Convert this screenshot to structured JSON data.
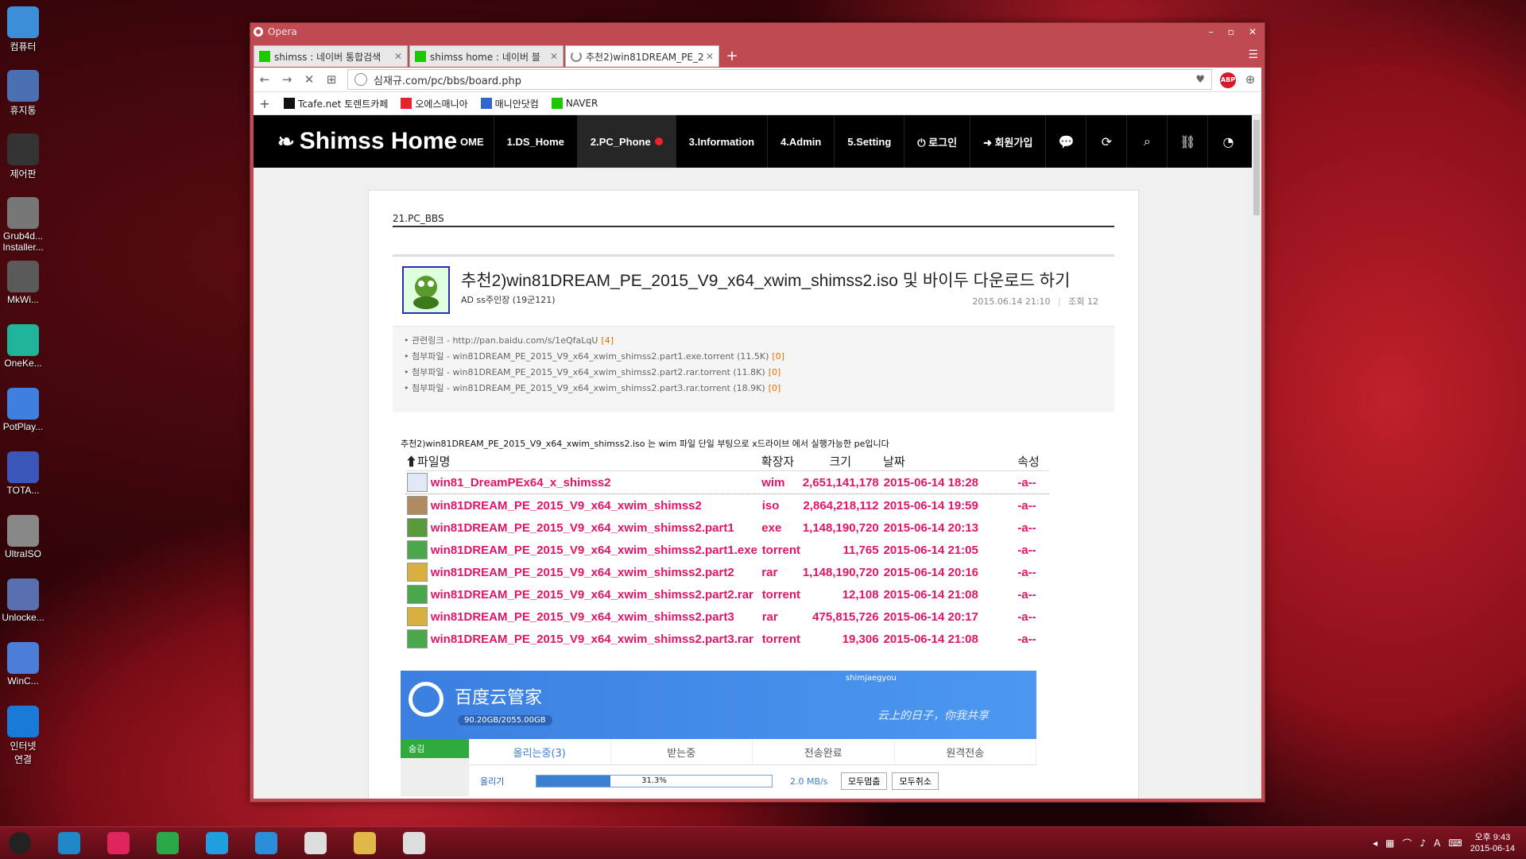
{
  "desktop": {
    "icons": [
      {
        "label": "컴퓨터",
        "color": "#3b8fd8"
      },
      {
        "label": "휴지통",
        "color": "#4a6fb2"
      },
      {
        "label": "제어판",
        "color": "#333333"
      },
      {
        "label": "Grub4d...\nInstaller...",
        "color": "#777777"
      },
      {
        "label": "MkWi...",
        "color": "#5a5a5a"
      },
      {
        "label": "OneKe...",
        "color": "#1db49a"
      },
      {
        "label": "PotPlay...",
        "color": "#3f7fe0"
      },
      {
        "label": "TOTA...",
        "color": "#3a56b8"
      },
      {
        "label": "UltraISO",
        "color": "#888888"
      },
      {
        "label": "Unlocke...",
        "color": "#5a6fb0"
      },
      {
        "label": "WinC...",
        "color": "#4a7ed8"
      },
      {
        "label": "인터넷\n연결",
        "color": "#1a7ad8"
      }
    ]
  },
  "browser": {
    "app_name": "Opera",
    "tabs": [
      {
        "title": "shimss : 네이버 통합검색",
        "fav_color": "#1ec800"
      },
      {
        "title": "shimss home : 네이버 블",
        "fav_color": "#1ec800"
      },
      {
        "title": "추천2)win81DREAM_PE_2",
        "fav_color": "#888888"
      }
    ],
    "new_tab": "+",
    "url": "심재규.com/pc/bbs/board.php",
    "bookmarks": [
      {
        "label": "Tcafe.net 토렌트카페",
        "color": "#111111"
      },
      {
        "label": "오에스매니아",
        "color": "#e8232c"
      },
      {
        "label": "매니안닷컴",
        "color": "#3366cc"
      },
      {
        "label": "NAVER",
        "color": "#1ec800"
      }
    ]
  },
  "site": {
    "logo": "Shimss Home",
    "nav": [
      {
        "label": "OME"
      },
      {
        "label": "1.DS_Home"
      },
      {
        "label": "2.PC_Phone"
      },
      {
        "label": "3.Information"
      },
      {
        "label": "4.Admin"
      },
      {
        "label": "5.Setting"
      },
      {
        "label": "⏻ 로그인"
      },
      {
        "label": "➜ 회원가입"
      }
    ],
    "board_name": "21.PC_BBS",
    "post": {
      "title": "추천2)win81DREAM_PE_2015_V9_x64_xwim_shimss2.iso 및 바이두 다운로드 하기",
      "author": "AD ss주인장 (19군121)",
      "date": "2015.06.14 21:10",
      "views": "조회 12",
      "links": [
        {
          "text": "관련링크 - http://pan.baidu.com/s/1eQfaLqU",
          "count": "[4]"
        },
        {
          "text": "첨부파일 - win81DREAM_PE_2015_V9_x64_xwim_shimss2.part1.exe.torrent (11.5K)",
          "count": "[0]"
        },
        {
          "text": "첨부파일 - win81DREAM_PE_2015_V9_x64_xwim_shimss2.part2.rar.torrent (11.8K)",
          "count": "[0]"
        },
        {
          "text": "첨부파일 - win81DREAM_PE_2015_V9_x64_xwim_shimss2.part3.rar.torrent (18.9K)",
          "count": "[0]"
        }
      ],
      "description": "추천2)win81DREAM_PE_2015_V9_x64_xwim_shimss2.iso 는 wim 파일 단일 부팅으로 x드라이브 에서 실행가능한 pe입니다"
    },
    "file_list": {
      "headers": [
        "파일명",
        "확장자",
        "크기",
        "날짜",
        "속성"
      ],
      "rows": [
        {
          "name": "win81_DreamPEx64_x_shimss2",
          "ext": "wim",
          "size": "2,651,141,178",
          "date": "2015-06-14 18:28",
          "attr": "-a--",
          "icon": "#dfe8f4"
        },
        {
          "name": "win81DREAM_PE_2015_V9_x64_xwim_shimss2",
          "ext": "iso",
          "size": "2,864,218,112",
          "date": "2015-06-14 19:59",
          "attr": "-a--",
          "icon": "#b08a60"
        },
        {
          "name": "win81DREAM_PE_2015_V9_x64_xwim_shimss2.part1",
          "ext": "exe",
          "size": "1,148,190,720",
          "date": "2015-06-14 20:13",
          "attr": "-a--",
          "icon": "#5a9a3a"
        },
        {
          "name": "win81DREAM_PE_2015_V9_x64_xwim_shimss2.part1.exe",
          "ext": "torrent",
          "size": "11,765",
          "date": "2015-06-14 21:05",
          "attr": "-a--",
          "icon": "#4aa84a"
        },
        {
          "name": "win81DREAM_PE_2015_V9_x64_xwim_shimss2.part2",
          "ext": "rar",
          "size": "1,148,190,720",
          "date": "2015-06-14 20:16",
          "attr": "-a--",
          "icon": "#d8b040"
        },
        {
          "name": "win81DREAM_PE_2015_V9_x64_xwim_shimss2.part2.rar",
          "ext": "torrent",
          "size": "12,108",
          "date": "2015-06-14 21:08",
          "attr": "-a--",
          "icon": "#4aa84a"
        },
        {
          "name": "win81DREAM_PE_2015_V9_x64_xwim_shimss2.part3",
          "ext": "rar",
          "size": "475,815,726",
          "date": "2015-06-14 20:17",
          "attr": "-a--",
          "icon": "#d8b040"
        },
        {
          "name": "win81DREAM_PE_2015_V9_x64_xwim_shimss2.part3.rar",
          "ext": "torrent",
          "size": "19,306",
          "date": "2015-06-14 21:08",
          "attr": "-a--",
          "icon": "#4aa84a"
        }
      ]
    },
    "baidu": {
      "title": "百度云管家",
      "storage": "90.20GB/2055.00GB",
      "user": "shimjaegyou",
      "slogan": "云上的日子，你我共享",
      "side_tab": "숨김",
      "tabs": [
        "올리는중(3)",
        "받는중",
        "전송완료",
        "원격전송"
      ],
      "upload_label": "올리기",
      "progress": "31.3%",
      "progress_value": 0.313,
      "speed": "2.0 MB/s",
      "pause_all": "모두멈춤",
      "cancel_all": "모두취소"
    }
  },
  "taskbar": {
    "items": [
      {
        "name": "start-orb",
        "color": "#222222"
      },
      {
        "name": "app-1",
        "color": "#1e88c8"
      },
      {
        "name": "app-2",
        "color": "#e0245e"
      },
      {
        "name": "app-3",
        "color": "#2aa84a"
      },
      {
        "name": "app-4",
        "color": "#1f9ee0"
      },
      {
        "name": "app-5",
        "color": "#2a8ed8"
      },
      {
        "name": "app-6",
        "color": "#dddddd"
      },
      {
        "name": "app-7",
        "color": "#e0b84a"
      },
      {
        "name": "app-8",
        "color": "#dddddd"
      }
    ],
    "time": "오후 9:43",
    "date": "2015-06-14"
  }
}
